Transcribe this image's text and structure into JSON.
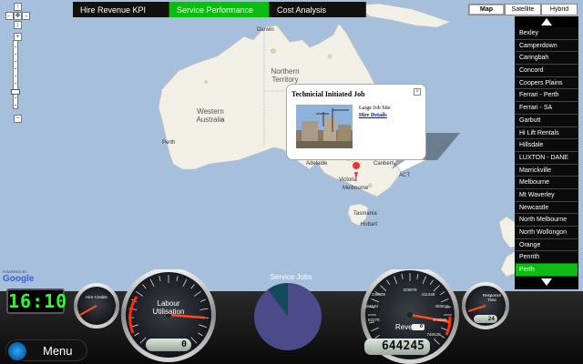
{
  "tabs": [
    {
      "label": "Hire Revenue KPI",
      "active": false
    },
    {
      "label": "Service Performance",
      "active": true
    },
    {
      "label": "Cost Analysis",
      "active": false
    }
  ],
  "map_types": [
    {
      "label": "Map",
      "active": true
    },
    {
      "label": "Satellite",
      "active": false
    },
    {
      "label": "Hybrid",
      "active": false
    }
  ],
  "map_labels": {
    "darwin": "Darwin",
    "northern_territory": "Northern Territory",
    "western_australia": "Western Australia",
    "perth": "Perth",
    "victoria": "Victoria",
    "melbourne": "Melbourne",
    "canberra": "Canberra",
    "act": "ACT",
    "adelaide": "Adelaide",
    "tasmania": "Tasmania",
    "hobart": "Hobart"
  },
  "info_window": {
    "title": "Technicial Initiated Job",
    "job_site": "Large Job Site",
    "link": "Hire Details"
  },
  "sites": [
    {
      "label": "Bexley",
      "active": false
    },
    {
      "label": "Camperdown",
      "active": false
    },
    {
      "label": "Caringbah",
      "active": false
    },
    {
      "label": "Concord",
      "active": false
    },
    {
      "label": "Coopers Plains",
      "active": false
    },
    {
      "label": "Ferrari - Perth",
      "active": false
    },
    {
      "label": "Ferrari - SA",
      "active": false
    },
    {
      "label": "Garbutt",
      "active": false
    },
    {
      "label": "Hi Lift Rentals",
      "active": false
    },
    {
      "label": "Hillsdale",
      "active": false
    },
    {
      "label": "LUXTON - DANE",
      "active": false
    },
    {
      "label": "Marrickville",
      "active": false
    },
    {
      "label": "Melbourne",
      "active": false
    },
    {
      "label": "Mt Waverley",
      "active": false
    },
    {
      "label": "Newcastle",
      "active": false
    },
    {
      "label": "North Melbourne",
      "active": false
    },
    {
      "label": "North Wollongon",
      "active": false
    },
    {
      "label": "Orange",
      "active": false
    },
    {
      "label": "Penrith",
      "active": false
    },
    {
      "label": "Perth",
      "active": true
    }
  ],
  "google": {
    "powered_by": "POWERED BY",
    "logo": "Google"
  },
  "clock": "16:10",
  "menu_label": "Menu",
  "gauges": {
    "hire_credits": {
      "label": "Hire Credits"
    },
    "labour": {
      "label_line1": "Labour",
      "label_line2": "Utilisation",
      "readout": "0",
      "value_fraction": 0.85
    },
    "revenue": {
      "label": "Revenue",
      "readout": "644245",
      "scale": [
        "0",
        "82270",
        "164540",
        "246809",
        "329079",
        "411349",
        "493619",
        "575888",
        "740428"
      ],
      "value_fraction": 0.87
    },
    "response": {
      "label_line1": "Response",
      "label_line2": "Time",
      "readout": "24"
    }
  },
  "service_jobs": {
    "title": "Service Jobs",
    "share_fraction": 0.9
  },
  "colors": {
    "accent_green": "#0dbb12",
    "clock_green": "#27ff27",
    "needle_red": "#ff4a1a"
  }
}
